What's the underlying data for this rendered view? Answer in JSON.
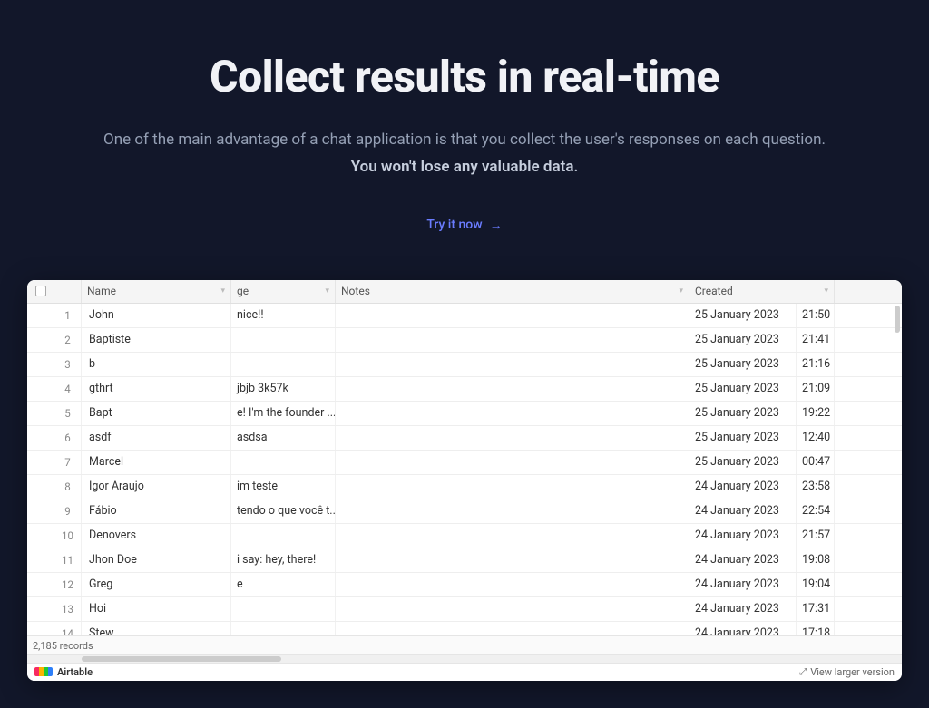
{
  "hero": {
    "title": "Collect results in real-time",
    "subline1": "One of the main advantage of a chat application is that you collect the user's responses on each question.",
    "subline2": "You won't lose any valuable data.",
    "cta_label": "Try it now"
  },
  "table": {
    "columns": {
      "name": "Name",
      "msg": "ge",
      "notes": "Notes",
      "created": "Created"
    },
    "rows": [
      {
        "idx": "1",
        "name": "John",
        "msg": "nice!!",
        "notes": "",
        "date": "25 January 2023",
        "time": "21:50"
      },
      {
        "idx": "2",
        "name": "Baptiste",
        "msg": "",
        "notes": "",
        "date": "25 January 2023",
        "time": "21:41"
      },
      {
        "idx": "3",
        "name": "b",
        "msg": "",
        "notes": "",
        "date": "25 January 2023",
        "time": "21:16"
      },
      {
        "idx": "4",
        "name": "gthrt",
        "msg": "jbjb 3k57k",
        "notes": "",
        "date": "25 January 2023",
        "time": "21:09"
      },
      {
        "idx": "5",
        "name": "Bapt",
        "msg": "e! I'm the founder ...",
        "notes": "",
        "date": "25 January 2023",
        "time": "19:22"
      },
      {
        "idx": "6",
        "name": "asdf",
        "msg": "asdsa",
        "notes": "",
        "date": "25 January 2023",
        "time": "12:40"
      },
      {
        "idx": "7",
        "name": "Marcel",
        "msg": "",
        "notes": "",
        "date": "25 January 2023",
        "time": "00:47"
      },
      {
        "idx": "8",
        "name": "Igor Araujo",
        "msg": "im teste",
        "notes": "",
        "date": "24 January 2023",
        "time": "23:58"
      },
      {
        "idx": "9",
        "name": "Fábio",
        "msg": "tendo o que você t...",
        "notes": "",
        "date": "24 January 2023",
        "time": "22:54"
      },
      {
        "idx": "10",
        "name": "Denovers",
        "msg": "",
        "notes": "",
        "date": "24 January 2023",
        "time": "21:57"
      },
      {
        "idx": "11",
        "name": "Jhon Doe",
        "msg": "i say: hey, there!",
        "notes": "",
        "date": "24 January 2023",
        "time": "19:08"
      },
      {
        "idx": "12",
        "name": "Greg",
        "msg": "e",
        "notes": "",
        "date": "24 January 2023",
        "time": "19:04"
      },
      {
        "idx": "13",
        "name": "Hoi",
        "msg": "",
        "notes": "",
        "date": "24 January 2023",
        "time": "17:31"
      },
      {
        "idx": "14",
        "name": "Stew",
        "msg": "",
        "notes": "",
        "date": "24 January 2023",
        "time": "17:18"
      }
    ],
    "records_label": "2,185 records",
    "brand": "Airtable",
    "view_larger": "View larger version"
  }
}
